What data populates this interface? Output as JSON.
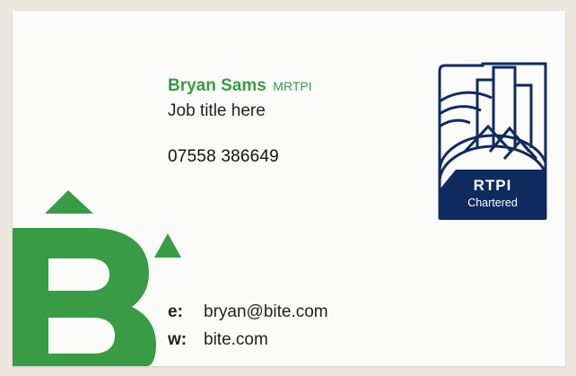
{
  "card": {
    "name": "Bryan Sams",
    "credential": "MRTPI",
    "job_title": "Job title here",
    "phone": "07558 386649",
    "email_label": "e:",
    "email": "bryan@bite.com",
    "web_label": "w:",
    "web": "bite.com"
  },
  "rtpi_badge": {
    "acronym": "RTPI",
    "status": "Chartered"
  },
  "colors": {
    "brand_green": "#3a9b47",
    "rtpi_navy": "#0f2a5f",
    "background": "#ede7df",
    "card": "#fbfbfa"
  },
  "icons": [
    "bite-logo",
    "rtpi-chartered-logo"
  ]
}
